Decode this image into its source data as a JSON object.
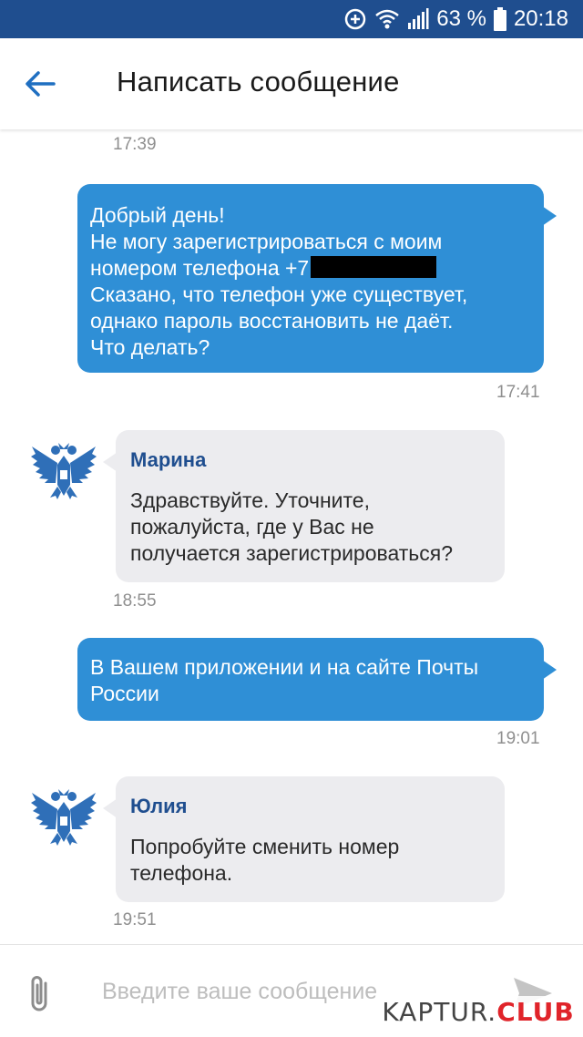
{
  "status_bar": {
    "battery_percent": "63 %",
    "time": "20:18"
  },
  "header": {
    "title": "Написать сообщение"
  },
  "messages": [
    {
      "direction": "out",
      "lines": [
        "Добрый день!",
        "Не могу зарегистрироваться с моим",
        "номером телефона +7",
        "Сказано, что телефон уже существует,",
        "однако пароль восстановить не даёт.",
        "Что делать?"
      ],
      "time_above": "17:39",
      "time": "17:41"
    },
    {
      "direction": "in",
      "sender": "Марина",
      "lines": [
        "Здравствуйте. Уточните,",
        "пожалуйста, где у Вас не",
        "получается зарегистрироваться?"
      ],
      "time": "18:55"
    },
    {
      "direction": "out",
      "lines": [
        "В Вашем приложении и на сайте Почты",
        "России"
      ],
      "time": "19:01"
    },
    {
      "direction": "in",
      "sender": "Юлия",
      "lines": [
        "Попробуйте сменить номер",
        "телефона."
      ],
      "time": "19:51"
    }
  ],
  "composer": {
    "placeholder": "Введите ваше сообщение"
  },
  "watermark": {
    "part1": "KAPTUR.",
    "part2": "CLUB"
  },
  "colors": {
    "status_bar": "#1f4e8f",
    "accent": "#2f8fd6",
    "incoming_bubble": "#ececef",
    "sender_name": "#1f4e8f"
  },
  "icons": {
    "status": [
      "data-saver-icon",
      "wifi-icon",
      "signal-icon",
      "battery-icon"
    ],
    "back": "arrow-left-icon",
    "avatar": "double-headed-eagle-icon",
    "attach": "paperclip-icon",
    "send": "send-icon"
  }
}
